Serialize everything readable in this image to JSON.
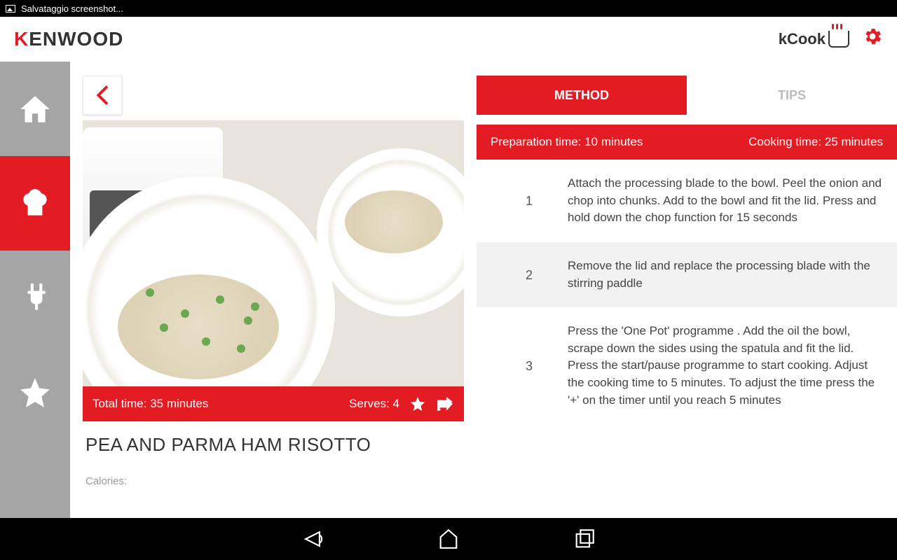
{
  "status": {
    "text": "Salvataggio screenshot..."
  },
  "header": {
    "brand_first": "K",
    "brand_rest": "ENWOOD",
    "kcook": "kCook"
  },
  "sidebar": {
    "items": [
      "home",
      "recipes",
      "appliances",
      "favorites"
    ]
  },
  "recipe": {
    "total_time_label": "Total time:",
    "total_time_value": "35 minutes",
    "serves_label": "Serves:",
    "serves_value": "4",
    "title": "PEA AND PARMA HAM RISOTTO",
    "calories_label": "Calories:"
  },
  "tabs": {
    "method": "METHOD",
    "tips": "TIPS"
  },
  "times": {
    "prep_label": "Preparation time:",
    "prep_value": "10 minutes",
    "cook_label": "Cooking time:",
    "cook_value": "25 minutes"
  },
  "steps": [
    {
      "n": "1",
      "text": "Attach the processing blade to the bowl. Peel the onion and chop into chunks. Add to the bowl and fit the lid. Press and hold down the chop function  for 15 seconds"
    },
    {
      "n": "2",
      "text": "Remove the lid and replace the processing blade with the stirring paddle"
    },
    {
      "n": "3",
      "text": "Press the 'One Pot' programme . Add the oil the  bowl, scrape down the sides using the spatula and fit the lid. Press the start/pause programme  to start cooking. Adjust the cooking time to 5 minutes. To adjust the time press the '+' on the timer  until you reach 5 minutes"
    }
  ]
}
